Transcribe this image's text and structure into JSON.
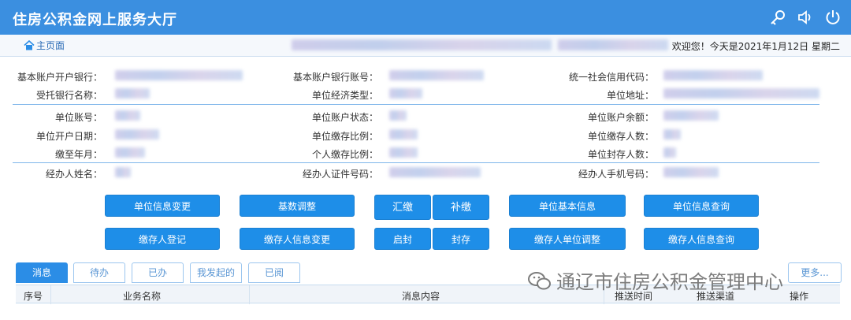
{
  "app": {
    "title": "住房公积金网上服务大厅"
  },
  "nav": {
    "home": "主页面",
    "welcome": "欢迎您！今天是2021年1月12日 星期二"
  },
  "fields": {
    "row1": [
      "基本账户开户银行：",
      "基本账户银行账号：",
      "统一社会信用代码："
    ],
    "row2": [
      "受托银行名称：",
      "单位经济类型：",
      "单位地址："
    ],
    "row3": [
      "单位账号：",
      "单位账户状态：",
      "单位账户余额："
    ],
    "row4": [
      "单位开户日期：",
      "单位缴存比例：",
      "单位缴存人数："
    ],
    "row5": [
      "缴至年月：",
      "个人缴存比例：",
      "单位封存人数："
    ],
    "row6": [
      "经办人姓名：",
      "经办人证件号码：",
      "经办人手机号码："
    ]
  },
  "buttons": {
    "unit_info_change": "单位信息变更",
    "base_adjust": "基数调整",
    "remit": "汇缴",
    "supplement": "补缴",
    "unit_basic_info": "单位基本信息",
    "unit_info_query": "单位信息查询",
    "depositor_register": "缴存人登记",
    "depositor_info_change": "缴存人信息变更",
    "unseal": "启封",
    "seal": "封存",
    "depositor_unit_adjust": "缴存人单位调整",
    "depositor_info_query": "缴存人信息查询"
  },
  "tabs": [
    "消息",
    "待办",
    "已办",
    "我发起的",
    "已阅"
  ],
  "more": "更多...",
  "table": {
    "headers": [
      "序号",
      "业务名称",
      "消息内容",
      "推送时间",
      "推送渠道",
      "操作"
    ]
  },
  "watermark": "通辽市住房公积金管理中心"
}
